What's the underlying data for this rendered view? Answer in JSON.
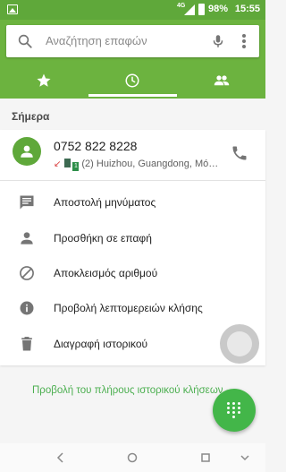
{
  "status_bar": {
    "network": "4G",
    "battery": "98%",
    "time": "15:55",
    "icons": [
      "image-icon",
      "signal-icon",
      "battery-icon"
    ]
  },
  "search": {
    "placeholder": "Αναζήτηση επαφών",
    "icons": [
      "search-icon",
      "mic-icon",
      "more-vert-icon"
    ]
  },
  "tabs": [
    {
      "name": "favorites",
      "icon": "star-icon",
      "active": false
    },
    {
      "name": "recents",
      "icon": "clock-icon",
      "active": true
    },
    {
      "name": "contacts",
      "icon": "people-icon",
      "active": false
    }
  ],
  "section": {
    "title": "Σήμερα"
  },
  "call": {
    "number": "0752 822 8228",
    "detail": "(2) Huizhou, Guangdong, Mó…",
    "sim_label": "1",
    "missed_arrow": "↙"
  },
  "actions": [
    {
      "label": "Αποστολή μηνύματος",
      "icon": "message-icon"
    },
    {
      "label": "Προσθήκη σε επαφή",
      "icon": "person-icon"
    },
    {
      "label": "Αποκλεισμός αριθμού",
      "icon": "block-icon"
    },
    {
      "label": "Προβολή λεπτομερειών κλήσης",
      "icon": "info-icon"
    },
    {
      "label": "Διαγραφή ιστορικού",
      "icon": "delete-icon"
    }
  ],
  "footer": {
    "full_history": "Προβολή του πλήρους ιστορικού κλήσεων"
  },
  "colors": {
    "primary": "#6cb33f",
    "status_bar": "#5fa83a",
    "accent": "#43b649",
    "link": "#4caf50",
    "missed": "#d93d3d"
  }
}
